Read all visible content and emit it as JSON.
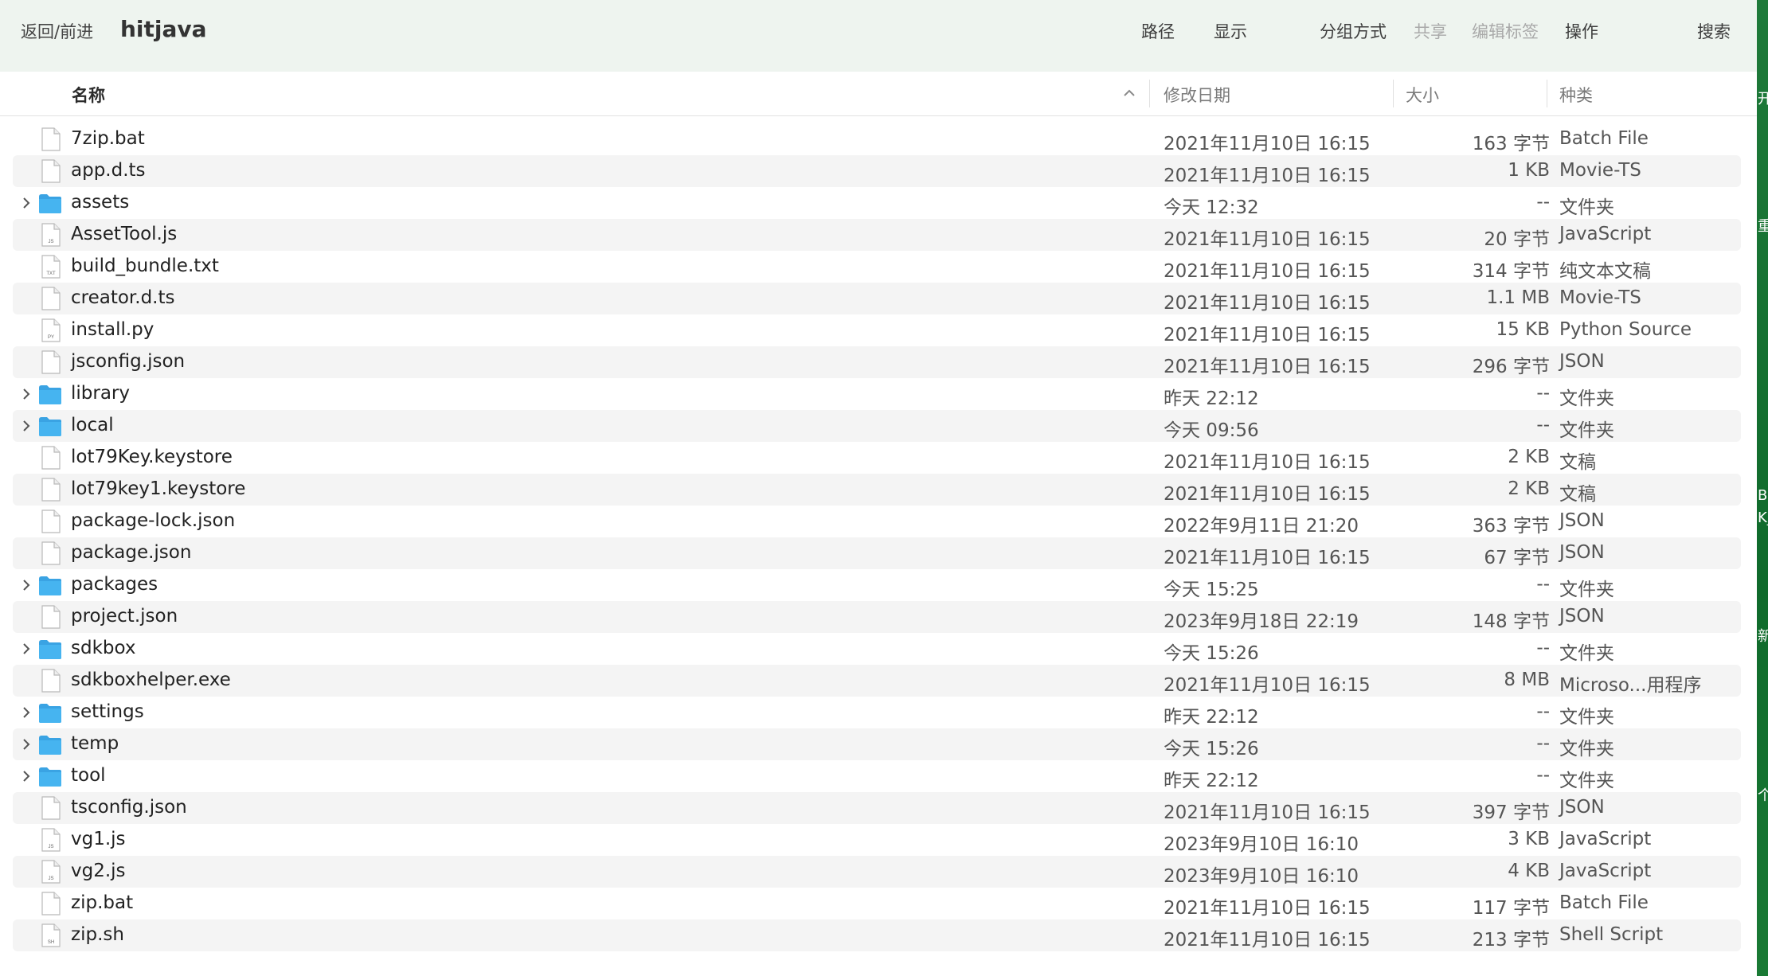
{
  "toolbar": {
    "nav_label": "返回/前进",
    "title": "hitjava",
    "path_label": "路径",
    "view_label": "显示",
    "group_label": "分组方式",
    "share_label": "共享",
    "tags_label": "编辑标签",
    "action_label": "操作",
    "search_label": "搜索"
  },
  "columns": {
    "name": "名称",
    "date": "修改日期",
    "size": "大小",
    "kind": "种类"
  },
  "colors": {
    "folder_blue": "#46b4f0",
    "toolbar_bg": "#eef4ef",
    "row_alt": "#f4f4f4",
    "side_green": "#1f7a3a"
  },
  "files": [
    {
      "name": "7zip.bat",
      "date": "2021年11月10日 16:15",
      "size": "163 字节",
      "kind": "Batch File",
      "type": "file",
      "icon": "document-icon"
    },
    {
      "name": "app.d.ts",
      "date": "2021年11月10日 16:15",
      "size": "1 KB",
      "kind": "Movie-TS",
      "type": "file",
      "icon": "document-icon"
    },
    {
      "name": "assets",
      "date": "今天 12:32",
      "size": "--",
      "kind": "文件夹",
      "type": "folder",
      "icon": "folder-icon"
    },
    {
      "name": "AssetTool.js",
      "date": "2021年11月10日 16:15",
      "size": "20 字节",
      "kind": "JavaScript",
      "type": "file",
      "icon": "js-file-icon",
      "badge": "JS"
    },
    {
      "name": "build_bundle.txt",
      "date": "2021年11月10日 16:15",
      "size": "314 字节",
      "kind": "纯文本文稿",
      "type": "file",
      "icon": "txt-file-icon",
      "badge": "TXT"
    },
    {
      "name": "creator.d.ts",
      "date": "2021年11月10日 16:15",
      "size": "1.1 MB",
      "kind": "Movie-TS",
      "type": "file",
      "icon": "document-icon"
    },
    {
      "name": "install.py",
      "date": "2021年11月10日 16:15",
      "size": "15 KB",
      "kind": "Python Source",
      "type": "file",
      "icon": "python-file-icon",
      "badge": "PY"
    },
    {
      "name": "jsconfig.json",
      "date": "2021年11月10日 16:15",
      "size": "296 字节",
      "kind": "JSON",
      "type": "file",
      "icon": "document-icon"
    },
    {
      "name": "library",
      "date": "昨天 22:12",
      "size": "--",
      "kind": "文件夹",
      "type": "folder",
      "icon": "folder-icon"
    },
    {
      "name": "local",
      "date": "今天 09:56",
      "size": "--",
      "kind": "文件夹",
      "type": "folder",
      "icon": "folder-icon"
    },
    {
      "name": "lot79Key.keystore",
      "date": "2021年11月10日 16:15",
      "size": "2 KB",
      "kind": "文稿",
      "type": "file",
      "icon": "document-icon"
    },
    {
      "name": "lot79key1.keystore",
      "date": "2021年11月10日 16:15",
      "size": "2 KB",
      "kind": "文稿",
      "type": "file",
      "icon": "document-icon"
    },
    {
      "name": "package-lock.json",
      "date": "2022年9月11日 21:20",
      "size": "363 字节",
      "kind": "JSON",
      "type": "file",
      "icon": "document-icon"
    },
    {
      "name": "package.json",
      "date": "2021年11月10日 16:15",
      "size": "67 字节",
      "kind": "JSON",
      "type": "file",
      "icon": "document-icon"
    },
    {
      "name": "packages",
      "date": "今天 15:25",
      "size": "--",
      "kind": "文件夹",
      "type": "folder",
      "icon": "folder-icon"
    },
    {
      "name": "project.json",
      "date": "2023年9月18日 22:19",
      "size": "148 字节",
      "kind": "JSON",
      "type": "file",
      "icon": "document-icon"
    },
    {
      "name": "sdkbox",
      "date": "今天 15:26",
      "size": "--",
      "kind": "文件夹",
      "type": "folder",
      "icon": "folder-icon"
    },
    {
      "name": "sdkboxhelper.exe",
      "date": "2021年11月10日 16:15",
      "size": "8 MB",
      "kind": "Microso...用程序",
      "type": "file",
      "icon": "document-icon"
    },
    {
      "name": "settings",
      "date": "昨天 22:12",
      "size": "--",
      "kind": "文件夹",
      "type": "folder",
      "icon": "folder-icon"
    },
    {
      "name": "temp",
      "date": "今天 15:26",
      "size": "--",
      "kind": "文件夹",
      "type": "folder",
      "icon": "folder-icon"
    },
    {
      "name": "tool",
      "date": "昨天 22:12",
      "size": "--",
      "kind": "文件夹",
      "type": "folder",
      "icon": "folder-icon"
    },
    {
      "name": "tsconfig.json",
      "date": "2021年11月10日 16:15",
      "size": "397 字节",
      "kind": "JSON",
      "type": "file",
      "icon": "document-icon"
    },
    {
      "name": "vg1.js",
      "date": "2023年9月10日 16:10",
      "size": "3 KB",
      "kind": "JavaScript",
      "type": "file",
      "icon": "js-file-icon",
      "badge": "JS"
    },
    {
      "name": "vg2.js",
      "date": "2023年9月10日 16:10",
      "size": "4 KB",
      "kind": "JavaScript",
      "type": "file",
      "icon": "js-file-icon",
      "badge": "JS"
    },
    {
      "name": "zip.bat",
      "date": "2021年11月10日 16:15",
      "size": "117 字节",
      "kind": "Batch File",
      "type": "file",
      "icon": "document-icon"
    },
    {
      "name": "zip.sh",
      "date": "2021年11月10日 16:15",
      "size": "213 字节",
      "kind": "Shell Script",
      "type": "file",
      "icon": "shell-file-icon",
      "badge": "SH"
    }
  ],
  "side_glyphs": [
    "开",
    "重",
    "B",
    "K_",
    "新",
    "个"
  ]
}
